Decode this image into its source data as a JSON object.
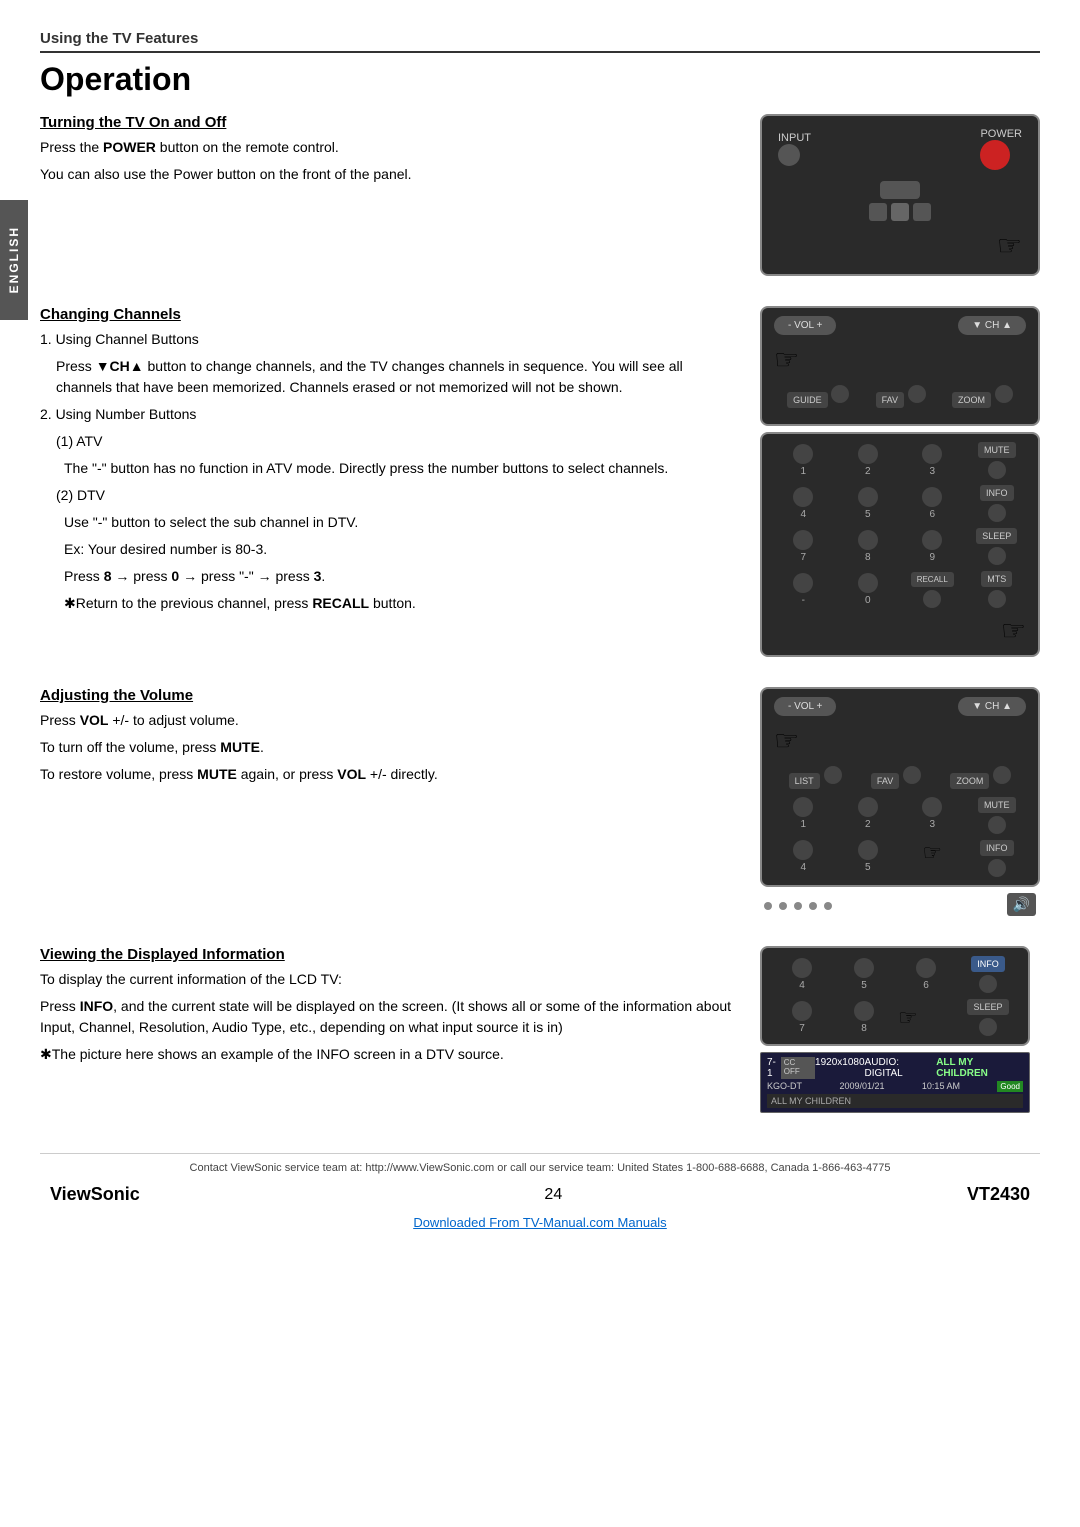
{
  "page": {
    "section_header": "Using the TV Features",
    "title": "Operation",
    "footer_contact": "Contact ViewSonic service team at: http://www.ViewSonic.com or call our service team: United States 1-800-688-6688, Canada 1-866-463-4775",
    "footer_brand": "ViewSonic",
    "footer_page": "24",
    "footer_model": "VT2430",
    "download_link": "Downloaded From TV-Manual.com Manuals"
  },
  "sections": {
    "turning_on_off": {
      "title": "Turning the TV On and Off",
      "text1": "Press the ",
      "bold1": "POWER",
      "text2": " button on the remote control.",
      "text3": "You can also use the Power button on the front of the panel."
    },
    "changing_channels": {
      "title": "Changing Channels",
      "item1": "Using Channel Buttons",
      "item1_text": "Press ▼CH▲ button to change channels, and the TV changes channels in sequence. You will see all channels that have been memorized. Channels erased or not memorized will not be shown.",
      "item2": "Using Number Buttons",
      "item2a": "(1) ATV",
      "item2a_text": "The \"-\" button has no function in ATV mode. Directly press the number buttons to select channels.",
      "item2b": "(2) DTV",
      "item2b_text1": "Use \"-\" button to select the sub channel in DTV.",
      "item2b_text2": "Ex: Your desired number is 80-3.",
      "item2b_text3": "Press 8 → press 0 → press \"-\" → press 3.",
      "item2b_text4": "✱Return to the previous channel, press ",
      "item2b_bold": "RECALL",
      "item2b_text5": " button."
    },
    "adjusting_volume": {
      "title": "Adjusting the Volume",
      "text1": "Press ",
      "bold1": "VOL",
      "text2": " +/- to adjust volume.",
      "text3": "To turn off the volume, press ",
      "bold2": "MUTE",
      "text4": ".",
      "text5": "To restore volume, press ",
      "bold3": "MUTE",
      "text6": " again, or press ",
      "bold4": "VOL",
      "text7": " +/- directly."
    },
    "viewing_info": {
      "title": "Viewing the Displayed Information",
      "text1": "To display the current information of the LCD TV:",
      "text2": "Press ",
      "bold1": "INFO",
      "text3": ", and the current state will be displayed on the screen. (It shows all or some of the information about Input, Channel, Resolution, Audio Type, etc., depending on what input source it is in)",
      "text4": "✱The picture here shows an example of the INFO screen in a DTV source."
    }
  },
  "remote_controls": {
    "top_buttons": {
      "input_label": "INPUT",
      "power_label": "POWER"
    },
    "ch_remote": {
      "vol_label": "- VOL +",
      "ch_label": "▼ CH ▲",
      "guide_label": "GUIDE",
      "fav_label": "FAV",
      "zoom_label": "ZOOM"
    },
    "num_remote": {
      "numbers": [
        "1",
        "2",
        "3",
        "4",
        "5",
        "6",
        "7",
        "8",
        "9",
        "-",
        "0"
      ],
      "right_labels": [
        "MUTE",
        "INFO",
        "SLEEP",
        "MTS"
      ],
      "recall_label": "RECALL"
    },
    "vol_remote2": {
      "vol_label": "- VOL +",
      "ch_label": "▼ CH ▲",
      "list_label": "LIST",
      "fav_label": "FAV",
      "zoom_label": "ZOOM",
      "mute_label": "MUTE",
      "info_label": "INFO",
      "numbers": [
        "1",
        "2",
        "3",
        "4",
        "5"
      ]
    },
    "info_remote": {
      "numbers": [
        "4",
        "5",
        "6",
        "7",
        "8"
      ],
      "info_label": "INFO",
      "sleep_label": "SLEEP"
    },
    "dots": [
      "•",
      "•",
      "•",
      "•",
      "•"
    ]
  },
  "info_screen": {
    "channel": "7-1",
    "station": "KGO-DT",
    "cc_label": "CC OFF",
    "resolution": "1920x1080",
    "audio": "AUDIO: DIGITAL",
    "program": "ALL MY CHILDREN",
    "date": "2009/01/21",
    "time": "10:15 AM",
    "good_label": "Good",
    "all_my_children": "ALL MY CHILDREN"
  }
}
